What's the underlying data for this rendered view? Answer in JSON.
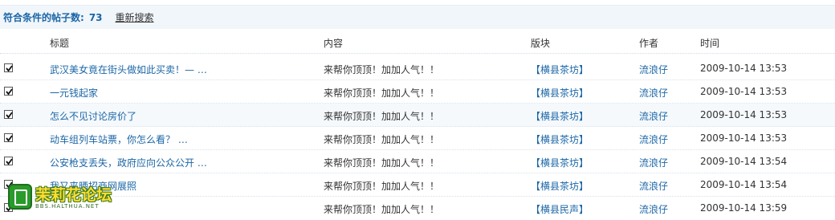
{
  "summary": {
    "label": "符合条件的帖子数:",
    "count": "73",
    "research_link": "重新搜索"
  },
  "columns": {
    "title": "标题",
    "content": "内容",
    "board": "版块",
    "author": "作者",
    "time": "时间"
  },
  "rows": [
    {
      "checked": true,
      "title": "武汉美女竟在街头做如此买卖！— …",
      "content": "来帮你顶顶！加加人气！！",
      "board": "【横县茶坊】",
      "author": "流浪仔",
      "time": "2009-10-14 13:53"
    },
    {
      "checked": true,
      "title": "一元钱起家",
      "content": "来帮你顶顶！加加人气！！",
      "board": "【横县茶坊】",
      "author": "流浪仔",
      "time": "2009-10-14 13:53"
    },
    {
      "checked": true,
      "title": "怎么不见讨论房价了",
      "content": "来帮你顶顶！加加人气！！",
      "board": "【横县茶坊】",
      "author": "流浪仔",
      "time": "2009-10-14 13:53"
    },
    {
      "checked": true,
      "title": "动车组列车站票，你怎么看？ …",
      "content": "来帮你顶顶！加加人气！！",
      "board": "【横县茶坊】",
      "author": "流浪仔",
      "time": "2009-10-14 13:53"
    },
    {
      "checked": true,
      "title": "公安枪支丢失，政府应向公众公开 …",
      "content": "来帮你顶顶！加加人气！！",
      "board": "【横县茶坊】",
      "author": "流浪仔",
      "time": "2009-10-14 13:54"
    },
    {
      "checked": true,
      "title": "我又来晒招商网展照",
      "content": "来帮你顶顶！加加人气！！",
      "board": "【横县茶坊】",
      "author": "流浪仔",
      "time": "2009-10-14 13:54"
    },
    {
      "checked": true,
      "title": "",
      "content": "来帮你顶顶！加加人气！！",
      "board": "【横县民声】",
      "author": "流浪仔",
      "time": "2009-10-14 13:59"
    }
  ],
  "watermark": {
    "name": "茉莉花论坛",
    "url": "BBS.HALTHUA.NET"
  },
  "icons": {
    "checkbox": "checkmark-icon",
    "logo": "forum-logo-icon"
  },
  "colors": {
    "link": "#1b66a6",
    "summary_bg": "#f1f6fb",
    "alt_row_bg": "#f5f9fc"
  }
}
